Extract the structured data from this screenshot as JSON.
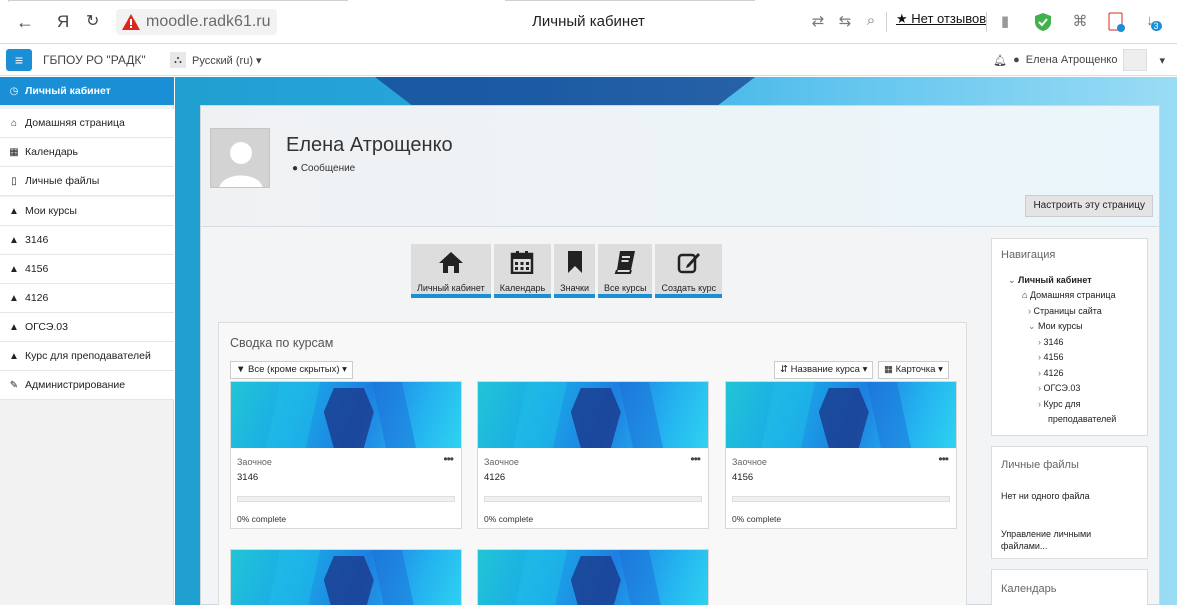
{
  "browser": {
    "yandex_glyph": "Я",
    "url": "moodle.radk61.ru",
    "tab_title": "Личный кабинет",
    "reviews_label": "★ Нет отзывов",
    "downloads_badge": "3"
  },
  "navbar": {
    "site_name": "ГБПОУ РО \"РАДК\"",
    "language": "Русский (ru) ▾",
    "user_name": "Елена Атрощенко",
    "menu_caret": "▾"
  },
  "drawer": {
    "items": [
      {
        "label": "Личный кабинет",
        "icon": "dashboard-icon"
      },
      {
        "label": "Домашняя страница",
        "icon": "home-icon"
      },
      {
        "label": "Календарь",
        "icon": "calendar-icon"
      },
      {
        "label": "Личные файлы",
        "icon": "file-icon"
      },
      {
        "label": "Мои курсы",
        "icon": "graduation-cap-icon"
      },
      {
        "label": "3146",
        "icon": "graduation-cap-icon"
      },
      {
        "label": "4156",
        "icon": "graduation-cap-icon"
      },
      {
        "label": "4126",
        "icon": "graduation-cap-icon"
      },
      {
        "label": "ОГСЭ.03",
        "icon": "graduation-cap-icon"
      },
      {
        "label": "Курс для преподавателей",
        "icon": "graduation-cap-icon"
      },
      {
        "label": "Администрирование",
        "icon": "wrench-icon"
      }
    ]
  },
  "header": {
    "user_name": "Елена Атрощенко",
    "message_label": "Сообщение",
    "customize_label": "Настроить эту страницу"
  },
  "quick_links": [
    {
      "label": "Личный кабинет",
      "icon": "home-icon"
    },
    {
      "label": "Календарь",
      "icon": "calendar-icon"
    },
    {
      "label": "Значки",
      "icon": "bookmark-icon"
    },
    {
      "label": "Все курсы",
      "icon": "book-icon"
    },
    {
      "label": "Создать курс",
      "icon": "edit-icon"
    }
  ],
  "overview": {
    "title": "Сводка по курсам",
    "filter_label": "Все (кроме скрытых) ▾",
    "sort_label": "Название курса ▾",
    "view_label": "Карточка ▾",
    "cards": [
      {
        "category": "Заочное",
        "name": "3146",
        "progress": 0,
        "progress_label": "0% complete"
      },
      {
        "category": "Заочное",
        "name": "4126",
        "progress": 0,
        "progress_label": "0% complete"
      },
      {
        "category": "Заочное",
        "name": "4156",
        "progress": 0,
        "progress_label": "0% complete"
      }
    ]
  },
  "nav_block": {
    "title": "Навигация",
    "root": "Личный кабинет",
    "home": "Домашняя страница",
    "site_pages": "Страницы сайта",
    "my_courses": "Мои курсы",
    "courses": [
      "3146",
      "4156",
      "4126",
      "ОГСЭ.03",
      "Курс для",
      "преподавателей"
    ]
  },
  "files_block": {
    "title": "Личные файлы",
    "empty": "Нет ни одного файла",
    "manage_1": "Управление личными",
    "manage_2": "файлами..."
  },
  "calendar_block": {
    "title": "Календарь"
  },
  "colors": {
    "accent": "#1a8fd6"
  }
}
